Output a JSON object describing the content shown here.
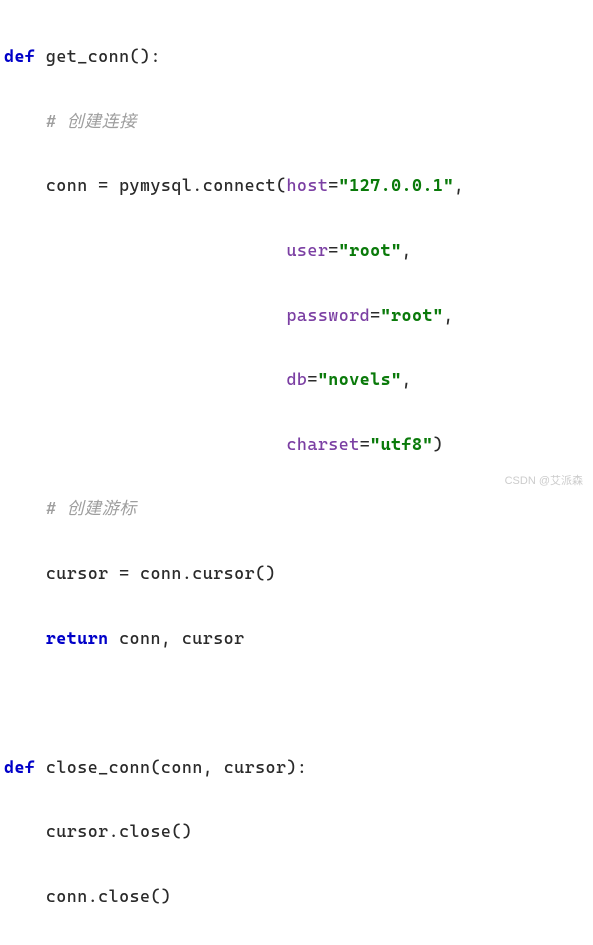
{
  "code": {
    "line1": {
      "def": "def",
      "name": " get_conn",
      "paren": "():"
    },
    "line2": {
      "indent": "    ",
      "comment": "# 创建连接"
    },
    "line3": {
      "indent": "    ",
      "assign": "conn = pymysql.connect(",
      "kw": "host",
      "eq": "=",
      "val": "\"127.0.0.1\"",
      "comma": ","
    },
    "line4": {
      "indent": "                           ",
      "kw": "user",
      "eq": "=",
      "val": "\"root\"",
      "comma": ","
    },
    "line5": {
      "indent": "                           ",
      "kw": "password",
      "eq": "=",
      "val": "\"root\"",
      "comma": ","
    },
    "line6": {
      "indent": "                           ",
      "kw": "db",
      "eq": "=",
      "val": "\"novels\"",
      "comma": ","
    },
    "line7": {
      "indent": "                           ",
      "kw": "charset",
      "eq": "=",
      "val": "\"utf8\"",
      "close": ")"
    },
    "line8": {
      "indent": "    ",
      "comment": "# 创建游标"
    },
    "line9": {
      "indent": "    ",
      "text": "cursor = conn.cursor()"
    },
    "line10": {
      "indent": "    ",
      "ret": "return",
      "rest": " conn, cursor"
    },
    "line12": {
      "def": "def",
      "name": " close_conn",
      "params": "(conn, cursor):"
    },
    "line13": {
      "indent": "    ",
      "text": "cursor.close()"
    },
    "line14": {
      "indent": "    ",
      "text": "conn.close()"
    }
  },
  "watermark": "CSDN @艾派森"
}
